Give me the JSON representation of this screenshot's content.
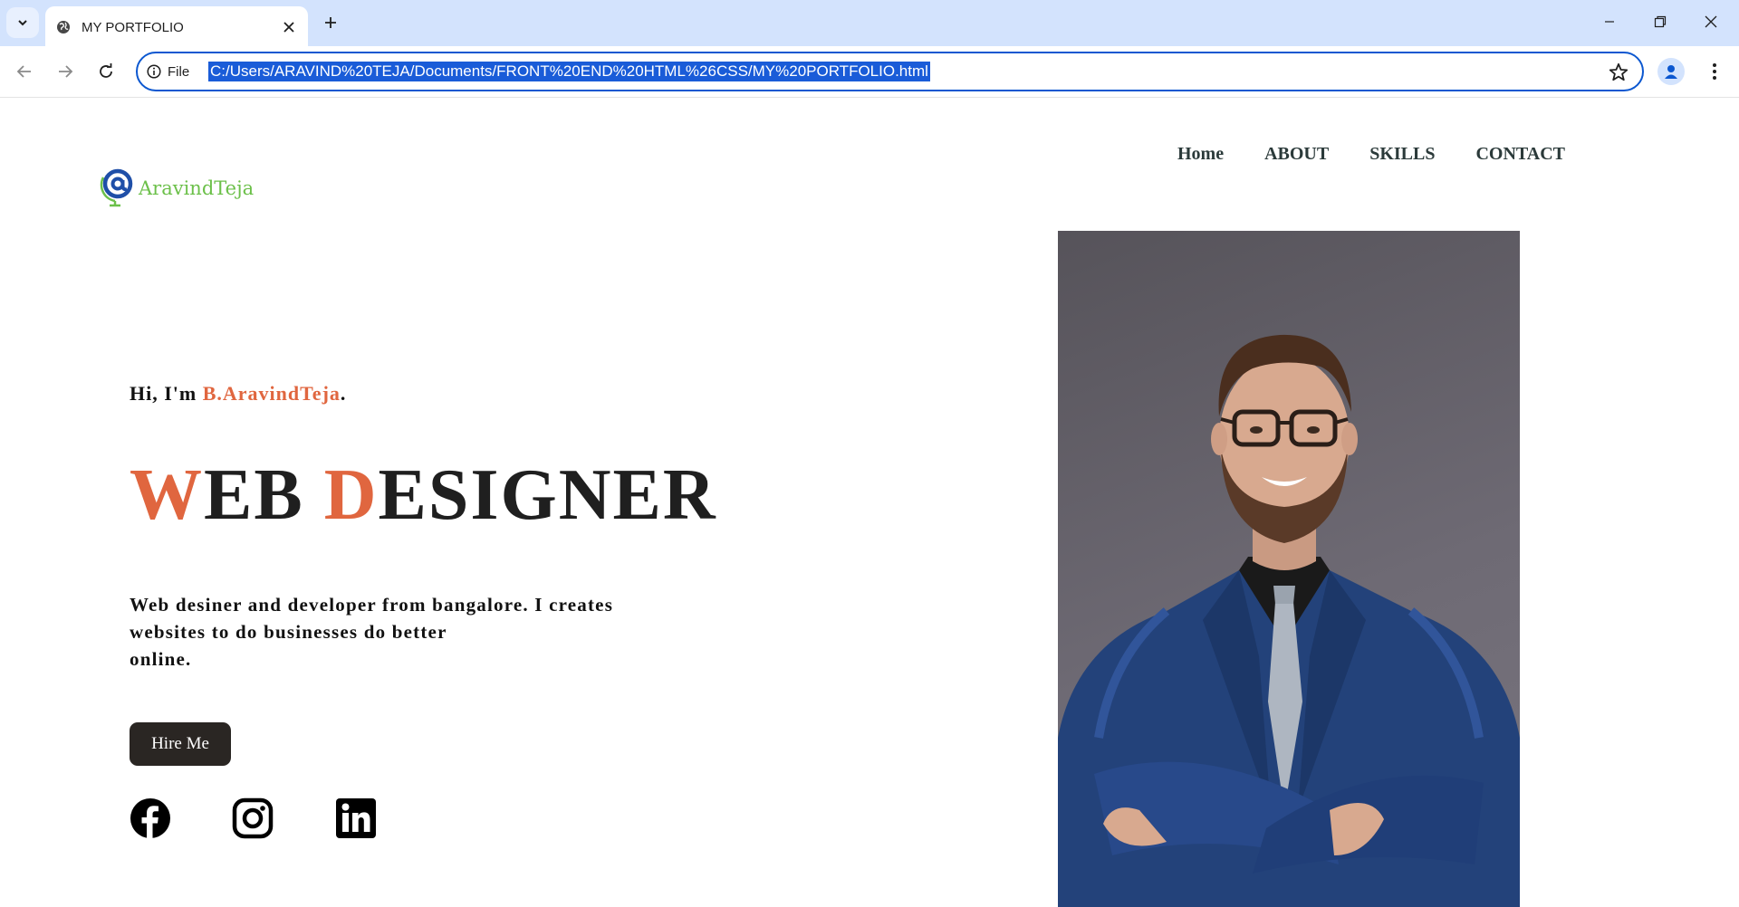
{
  "browser": {
    "tab_title": "MY PORTFOLIO",
    "site_info_label": "File",
    "url": "C:/Users/ARAVIND%20TEJA/Documents/FRONT%20END%20HTML%26CSS/MY%20PORTFOLIO.html",
    "icons": [
      "tab-search-icon",
      "globe-icon",
      "close-icon",
      "plus-icon",
      "minimize-icon",
      "restore-icon",
      "window-close-icon",
      "back-icon",
      "forward-icon",
      "reload-icon",
      "info-icon",
      "star-icon",
      "profile-icon",
      "more-vert-icon"
    ]
  },
  "page": {
    "logo_text": "AravindTeja",
    "nav": [
      "Home",
      "ABOUT",
      "SKILLS",
      "CONTACT"
    ],
    "greeting_prefix": "Hi, I'm ",
    "greeting_name": "B.AravindTeja",
    "greeting_suffix": ".",
    "headline": {
      "w1_first": "W",
      "w1_rest": "EB ",
      "w2_first": "D",
      "w2_rest": "ESIGNER"
    },
    "description": {
      "line1": "Web desiner and developer from bangalore. I creates",
      "line2": "websites to do businesses do better",
      "line3": "online."
    },
    "hire_button": "Hire Me",
    "social_icons": [
      "facebook-icon",
      "instagram-icon",
      "linkedin-icon"
    ],
    "accent_color": "#e0663f",
    "logo_color": "#6cc04a"
  }
}
